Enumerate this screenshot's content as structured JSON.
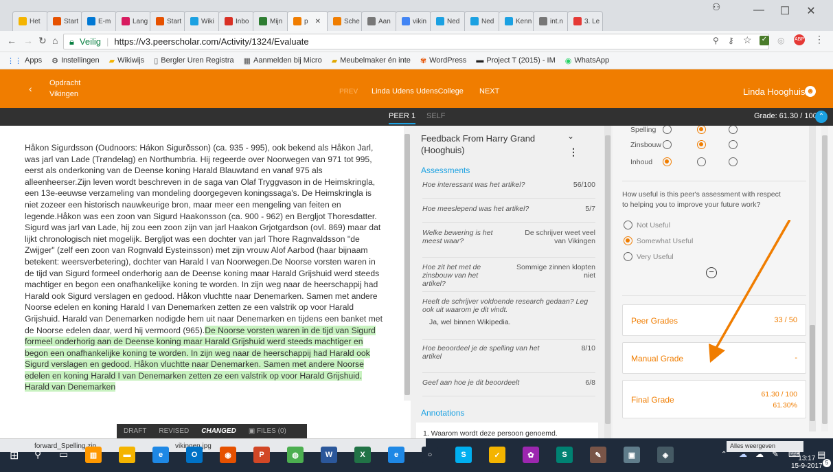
{
  "browser": {
    "tabs": [
      "Het",
      "Start",
      "E-m",
      "Lang",
      "Start",
      "Wiki",
      "Inbo",
      "Mijn",
      "p",
      "Sche",
      "Aan",
      "vikin",
      "Ned",
      "Ned",
      "Kenn",
      "int.n",
      "3. Le"
    ],
    "url_secure_label": "Veilig",
    "url": "https://v3.peerscholar.com/Activity/1324/Evaluate",
    "bookmarks": [
      "Apps",
      "Instellingen",
      "Wikiwijs",
      "Bergler Uren Registra",
      "Aanmelden bij Micro",
      "Meubelmaker én inte",
      "WordPress",
      "Project T (2015) - IM",
      "WhatsApp"
    ]
  },
  "header": {
    "back_label": "Opdracht",
    "course": "Vikingen",
    "prev": "PREV",
    "student": "Linda Udens UdensCollege",
    "next": "NEXT",
    "user": "Linda Hooghuis"
  },
  "subbar": {
    "tab_peer": "PEER 1",
    "tab_self": "SELF",
    "grade": "Grade: 61.30 / 100"
  },
  "essay": {
    "paragraph": "Håkon Sigurdsson (Oudnoors: Hákon Sigurðsson) (ca. 935 - 995), ook bekend als Håkon Jarl, was jarl van Lade (Trøndelag) en Northumbria. Hij regeerde over Noorwegen van 971 tot 995, eerst als onderkoning van de Deense koning Harald Blauwtand en vanaf 975 als alleenheerser.Zijn leven wordt beschreven in de saga van Olaf Tryggvason in de Heimskringla, een 13e-eeuwse verzameling van mondeling doorgegeven koningssaga's. De Heimskringla is niet zozeer een historisch nauwkeurige bron, maar meer een mengeling van feiten en legende.Håkon was een zoon van Sigurd Haakonsson (ca. 900 - 962) en Bergljot Thoresdatter. Sigurd was jarl van Lade, hij zou een zoon zijn van jarl Haakon Grjotgardson (ovl. 869) maar dat lijkt chronologisch niet mogelijk. Bergljot was een dochter van jarl Thore Ragnvaldsson \"de Zwijger\" (zelf een zoon van Rognvald Eysteinsson) met zijn vrouw Alof Aarbod (haar bijnaam betekent: weersverbetering), dochter van Harald I van Noorwegen.De Noorse vorsten waren in de tijd van Sigurd formeel onderhorig aan de Deense koning maar Harald Grijshuid werd steeds machtiger en begon een onafhankelijke koning te worden. In zijn weg naar de heerschappij had Harald ook Sigurd verslagen en gedood. Håkon vluchtte naar Denemarken. Samen met andere Noorse edelen en koning Harald I van Denemarken zetten ze een valstrik op voor Harald Grijshuid. Harald van Denemarken nodigde hem uit naar Denemarken en tijdens een banket met de Noorse edelen daar, werd hij vermoord (965).",
    "highlighted": "De Noorse vorsten waren in de tijd van Sigurd formeel onderhorig aan de Deense koning maar Harald Grijshuid werd steeds machtiger en begon een onafhankelijke koning te worden. In zijn weg naar de heerschappij had Harald ook Sigurd verslagen en gedood. Håkon vluchtte naar Denemarken. Samen met andere Noorse edelen en koning Harald I van Denemarken zetten ze een valstrik op voor Harald Grijshuid. Harald van Denemarken",
    "footer": {
      "draft": "DRAFT",
      "revised": "REVISED",
      "changed": "CHANGED",
      "files": "FILES (0)"
    }
  },
  "feedback": {
    "title": "Feedback From Harry Grand (Hooghuis)",
    "assessments_label": "Assessments",
    "questions": [
      {
        "q": "Hoe interessant was het artikel?",
        "a": "56/100"
      },
      {
        "q": "Hoe meeslepend was het artikel?",
        "a": "5/7"
      },
      {
        "q": "Welke bewering is het meest waar?",
        "a": "De schrijver weet veel van Vikingen"
      },
      {
        "q": "Hoe zit het met de zinsbouw van het artikel?",
        "a": "Sommige zinnen klopten niet"
      },
      {
        "q": "Heeft de schrijver voldoende research gedaan? Leg ook uit waarom je dit vindt.",
        "a": "Ja, wel binnen Wikipedia."
      },
      {
        "q": "Hoe beoordeel je de spelling van het artikel",
        "a": "8/10"
      },
      {
        "q": "Geef aan hoe je dit beoordeelt",
        "a": "6/8"
      }
    ],
    "annotations_label": "Annotations",
    "annotation_1": "1. Waarom wordt deze persoon genoemd."
  },
  "rubric": {
    "rows": [
      {
        "label": "Spelling",
        "selected": 1
      },
      {
        "label": "Zinsbouw",
        "selected": 1
      },
      {
        "label": "Inhoud",
        "selected": 0
      }
    ],
    "usefulness_question": "How useful is this peer's assessment with respect to helping you to improve your future work?",
    "options": [
      "Not Useful",
      "Somewhat Useful",
      "Very Useful"
    ],
    "selected_option": 1
  },
  "grades": {
    "peer_label": "Peer Grades",
    "peer_value": "33 / 50",
    "manual_label": "Manual Grade",
    "manual_value": "-",
    "final_label": "Final Grade",
    "final_value": "61.30 / 100",
    "final_percent": "61.30%"
  },
  "taskbar": {
    "time": "13:17",
    "date": "15-9-2017",
    "file1": "forward_Spelling.zip",
    "file2": "vikingen.jpg",
    "notice": "Alles weergeven",
    "notif_count": "5"
  },
  "colors": {
    "accent": "#f07d00",
    "header_dark": "#313131",
    "highlight": "#c8f2c0",
    "link_blue": "#1ba1e2"
  }
}
